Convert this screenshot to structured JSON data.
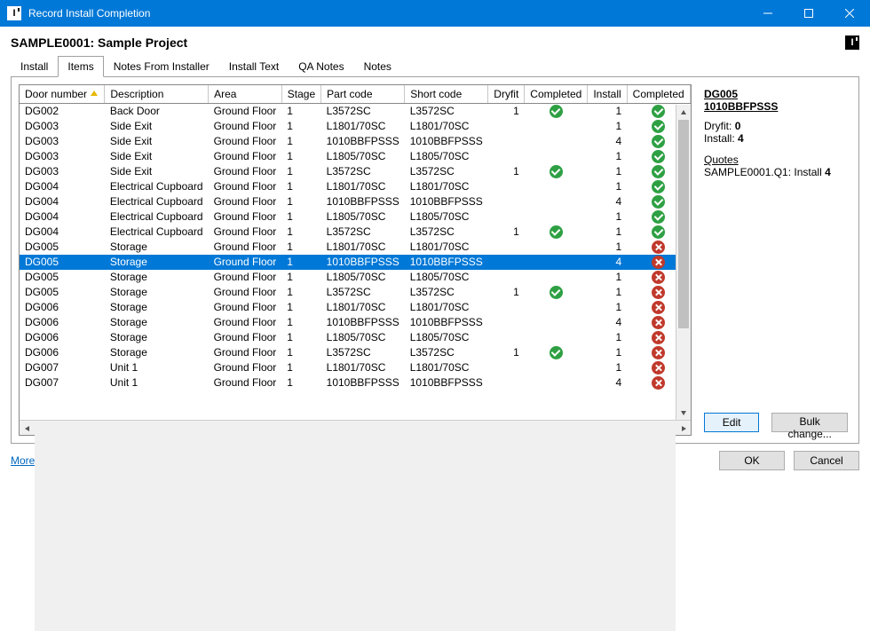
{
  "window": {
    "title": "Record Install Completion"
  },
  "project": {
    "code": "SAMPLE0001",
    "name": "Sample Project",
    "title": "SAMPLE0001: Sample Project"
  },
  "tabs": {
    "list": [
      {
        "label": "Install"
      },
      {
        "label": "Items"
      },
      {
        "label": "Notes From Installer"
      },
      {
        "label": "Install Text"
      },
      {
        "label": "QA Notes"
      },
      {
        "label": "Notes"
      }
    ],
    "active_index": 1
  },
  "columns": [
    {
      "label": "Door number",
      "sort": "asc"
    },
    {
      "label": "Description"
    },
    {
      "label": "Area"
    },
    {
      "label": "Stage"
    },
    {
      "label": "Part code"
    },
    {
      "label": "Short code"
    },
    {
      "label": "Dryfit"
    },
    {
      "label": "Completed"
    },
    {
      "label": "Install"
    },
    {
      "label": "Completed"
    }
  ],
  "rows": [
    {
      "door": "DG002",
      "desc": "Back Door",
      "area": "Ground Floor",
      "stage": "1",
      "part": "L3572SC",
      "short": "L3572SC",
      "dryfit": "1",
      "d_done": true,
      "install": "1",
      "i_done": true,
      "edit": true
    },
    {
      "door": "DG003",
      "desc": "Side Exit",
      "area": "Ground Floor",
      "stage": "1",
      "part": "L1801/70SC",
      "short": "L1801/70SC",
      "dryfit": "",
      "d_done": false,
      "install": "1",
      "i_done": true,
      "edit": true
    },
    {
      "door": "DG003",
      "desc": "Side Exit",
      "area": "Ground Floor",
      "stage": "1",
      "part": "1010BBFPSSS",
      "short": "1010BBFPSSS",
      "dryfit": "",
      "d_done": false,
      "install": "4",
      "i_done": true,
      "edit": true
    },
    {
      "door": "DG003",
      "desc": "Side Exit",
      "area": "Ground Floor",
      "stage": "1",
      "part": "L1805/70SC",
      "short": "L1805/70SC",
      "dryfit": "",
      "d_done": false,
      "install": "1",
      "i_done": true,
      "edit": true
    },
    {
      "door": "DG003",
      "desc": "Side Exit",
      "area": "Ground Floor",
      "stage": "1",
      "part": "L3572SC",
      "short": "L3572SC",
      "dryfit": "1",
      "d_done": true,
      "install": "1",
      "i_done": true,
      "edit": true
    },
    {
      "door": "DG004",
      "desc": "Electrical Cupboard",
      "area": "Ground Floor",
      "stage": "1",
      "part": "L1801/70SC",
      "short": "L1801/70SC",
      "dryfit": "",
      "d_done": false,
      "install": "1",
      "i_done": true,
      "edit": true
    },
    {
      "door": "DG004",
      "desc": "Electrical Cupboard",
      "area": "Ground Floor",
      "stage": "1",
      "part": "1010BBFPSSS",
      "short": "1010BBFPSSS",
      "dryfit": "",
      "d_done": false,
      "install": "4",
      "i_done": true,
      "edit": true
    },
    {
      "door": "DG004",
      "desc": "Electrical Cupboard",
      "area": "Ground Floor",
      "stage": "1",
      "part": "L1805/70SC",
      "short": "L1805/70SC",
      "dryfit": "",
      "d_done": false,
      "install": "1",
      "i_done": true,
      "edit": true
    },
    {
      "door": "DG004",
      "desc": "Electrical Cupboard",
      "area": "Ground Floor",
      "stage": "1",
      "part": "L3572SC",
      "short": "L3572SC",
      "dryfit": "1",
      "d_done": true,
      "install": "1",
      "i_done": true,
      "edit": true
    },
    {
      "door": "DG005",
      "desc": "Storage",
      "area": "Ground Floor",
      "stage": "1",
      "part": "L1801/70SC",
      "short": "L1801/70SC",
      "dryfit": "",
      "d_done": false,
      "install": "1",
      "i_done": false,
      "edit": true
    },
    {
      "door": "DG005",
      "desc": "Storage",
      "area": "Ground Floor",
      "stage": "1",
      "part": "1010BBFPSSS",
      "short": "1010BBFPSSS",
      "dryfit": "",
      "d_done": false,
      "install": "4",
      "i_done": false,
      "edit": false,
      "selected": true
    },
    {
      "door": "DG005",
      "desc": "Storage",
      "area": "Ground Floor",
      "stage": "1",
      "part": "L1805/70SC",
      "short": "L1805/70SC",
      "dryfit": "",
      "d_done": false,
      "install": "1",
      "i_done": false,
      "edit": false
    },
    {
      "door": "DG005",
      "desc": "Storage",
      "area": "Ground Floor",
      "stage": "1",
      "part": "L3572SC",
      "short": "L3572SC",
      "dryfit": "1",
      "d_done": true,
      "install": "1",
      "i_done": false,
      "edit": false
    },
    {
      "door": "DG006",
      "desc": "Storage",
      "area": "Ground Floor",
      "stage": "1",
      "part": "L1801/70SC",
      "short": "L1801/70SC",
      "dryfit": "",
      "d_done": false,
      "install": "1",
      "i_done": false,
      "edit": false
    },
    {
      "door": "DG006",
      "desc": "Storage",
      "area": "Ground Floor",
      "stage": "1",
      "part": "1010BBFPSSS",
      "short": "1010BBFPSSS",
      "dryfit": "",
      "d_done": false,
      "install": "4",
      "i_done": false,
      "edit": false
    },
    {
      "door": "DG006",
      "desc": "Storage",
      "area": "Ground Floor",
      "stage": "1",
      "part": "L1805/70SC",
      "short": "L1805/70SC",
      "dryfit": "",
      "d_done": false,
      "install": "1",
      "i_done": false,
      "edit": false
    },
    {
      "door": "DG006",
      "desc": "Storage",
      "area": "Ground Floor",
      "stage": "1",
      "part": "L3572SC",
      "short": "L3572SC",
      "dryfit": "1",
      "d_done": true,
      "install": "1",
      "i_done": false,
      "edit": false
    },
    {
      "door": "DG007",
      "desc": "Unit 1",
      "area": "Ground Floor",
      "stage": "1",
      "part": "L1801/70SC",
      "short": "L1801/70SC",
      "dryfit": "",
      "d_done": false,
      "install": "1",
      "i_done": false,
      "edit": false
    },
    {
      "door": "DG007",
      "desc": "Unit 1",
      "area": "Ground Floor",
      "stage": "1",
      "part": "1010BBFPSSS",
      "short": "1010BBFPSSS",
      "dryfit": "",
      "d_done": false,
      "install": "4",
      "i_done": false,
      "edit": false
    }
  ],
  "side_panel": {
    "door": "DG005",
    "part": "1010BBFPSSS",
    "dryfit_label": "Dryfit:",
    "dryfit_value": "0",
    "install_label": "Install:",
    "install_value": "4",
    "quotes_header": "Quotes",
    "quote_line_prefix": "SAMPLE0001.Q1: Install",
    "quote_line_value": "4",
    "edit_button": "Edit",
    "bulk_button": "Bulk change..."
  },
  "footer": {
    "more_tasks": "More tasks",
    "ok": "OK",
    "cancel": "Cancel"
  }
}
